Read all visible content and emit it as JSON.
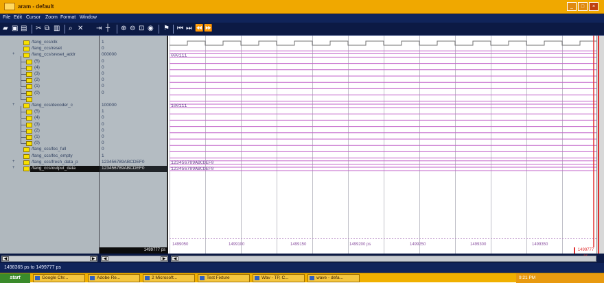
{
  "window": {
    "title": "aram - default",
    "controls": [
      "_",
      "□",
      "×"
    ]
  },
  "menu": [
    "File",
    "Edit",
    "Cursor",
    "Zoom",
    "Format",
    "Window"
  ],
  "signals": [
    {
      "name": "/fang_ccs/clk",
      "value": "1",
      "indent": 1,
      "expander": ""
    },
    {
      "name": "/fang_ccs/reset",
      "value": "0",
      "indent": 1,
      "expander": ""
    },
    {
      "name": "/fang_ccs/sreset_addr",
      "value": "000000",
      "indent": 1,
      "expander": "+"
    },
    {
      "name": "(5)",
      "value": "0",
      "indent": 2,
      "expander": ""
    },
    {
      "name": "(4)",
      "value": "0",
      "indent": 2,
      "expander": ""
    },
    {
      "name": "(3)",
      "value": "0",
      "indent": 2,
      "expander": ""
    },
    {
      "name": "(2)",
      "value": "0",
      "indent": 2,
      "expander": ""
    },
    {
      "name": "(1)",
      "value": "0",
      "indent": 2,
      "expander": ""
    },
    {
      "name": "(0)",
      "value": "0",
      "indent": 2,
      "expander": ""
    },
    {
      "name": "",
      "value": "",
      "indent": 2,
      "expander": ""
    },
    {
      "name": "/fang_ccs/decoder_c",
      "value": "100000",
      "indent": 1,
      "expander": "+"
    },
    {
      "name": "(5)",
      "value": "1",
      "indent": 2,
      "expander": ""
    },
    {
      "name": "(4)",
      "value": "0",
      "indent": 2,
      "expander": ""
    },
    {
      "name": "(3)",
      "value": "0",
      "indent": 2,
      "expander": ""
    },
    {
      "name": "(2)",
      "value": "0",
      "indent": 2,
      "expander": ""
    },
    {
      "name": "(1)",
      "value": "0",
      "indent": 2,
      "expander": ""
    },
    {
      "name": "(0)",
      "value": "0",
      "indent": 2,
      "expander": ""
    },
    {
      "name": "/fang_ccs/fec_full",
      "value": "0",
      "indent": 1,
      "expander": ""
    },
    {
      "name": "/fang_ccs/fec_empty",
      "value": "1",
      "indent": 1,
      "expander": ""
    },
    {
      "name": "/fang_ccs/fresh_data_p",
      "value": "123456789ABCDEF0",
      "indent": 1,
      "expander": "+"
    },
    {
      "name": "/fang_ccs/output_data",
      "value": "123456789ABCDEF0",
      "indent": 1,
      "expander": "+",
      "selected": true
    }
  ],
  "waveform": {
    "bus_labels": [
      {
        "row": 2,
        "text": "000111"
      },
      {
        "row": 10,
        "text": "100111"
      },
      {
        "row": 19,
        "text": "123456789ABCDEF0"
      },
      {
        "row": 20,
        "text": "123456789ABCDEF0"
      }
    ],
    "time_labels": [
      "1499050",
      "1499100",
      "1499150",
      "1499200 ps",
      "1499250",
      "1499300",
      "1499350"
    ],
    "cursor_time": "1499777 ps",
    "cursor_marker": "1499777 ps"
  },
  "status": {
    "range_text": "1498365 ps to 1499777 ps"
  },
  "taskbar": {
    "start_label": "start",
    "tasks": [
      "Google Chr...",
      "Adobe Re...",
      "2 Microsoft...",
      "Test Fixture",
      "Wav - TP, C...",
      "wave - defa..."
    ],
    "tray_text": "9:21 PM"
  }
}
